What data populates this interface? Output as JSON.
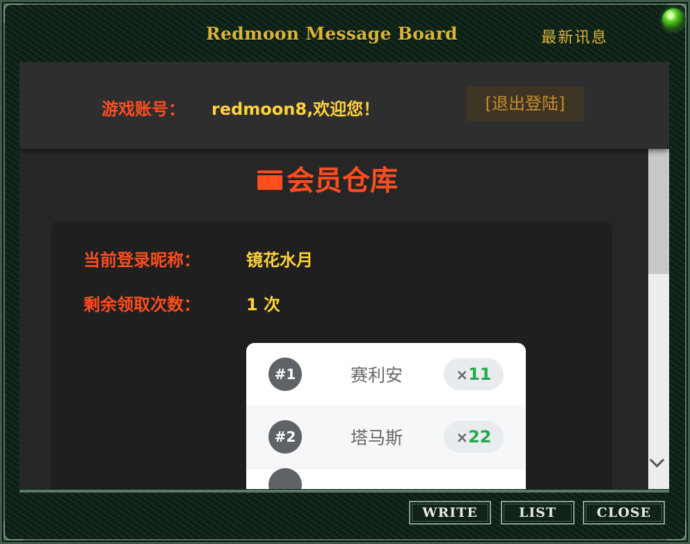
{
  "window": {
    "title": "Redmoon Message Board",
    "news_label": "最新讯息"
  },
  "header": {
    "account_label": "游戏账号：",
    "account_value": "redmoon8,欢迎您！",
    "logout_label": "[退出登陆]"
  },
  "section": {
    "title": "会员仓库",
    "icon": "box-icon"
  },
  "info": {
    "nickname_label": "当前登录昵称：",
    "nickname_value": "镜花水月",
    "remaining_label": "剩余领取次数：",
    "remaining_value": "1 次"
  },
  "items": [
    {
      "rank": "#1",
      "name": "赛利安",
      "qty_prefix": "×",
      "qty": "11"
    },
    {
      "rank": "#2",
      "name": "塔马斯",
      "qty_prefix": "×",
      "qty": "22"
    }
  ],
  "buttons": {
    "write": "WRITE",
    "list": "LIST",
    "close": "CLOSE"
  },
  "colors": {
    "accent": "#ff4d1f",
    "gold": "#ffd23c",
    "title_gold": "#d9b43c",
    "qty_green": "#23a84a"
  }
}
